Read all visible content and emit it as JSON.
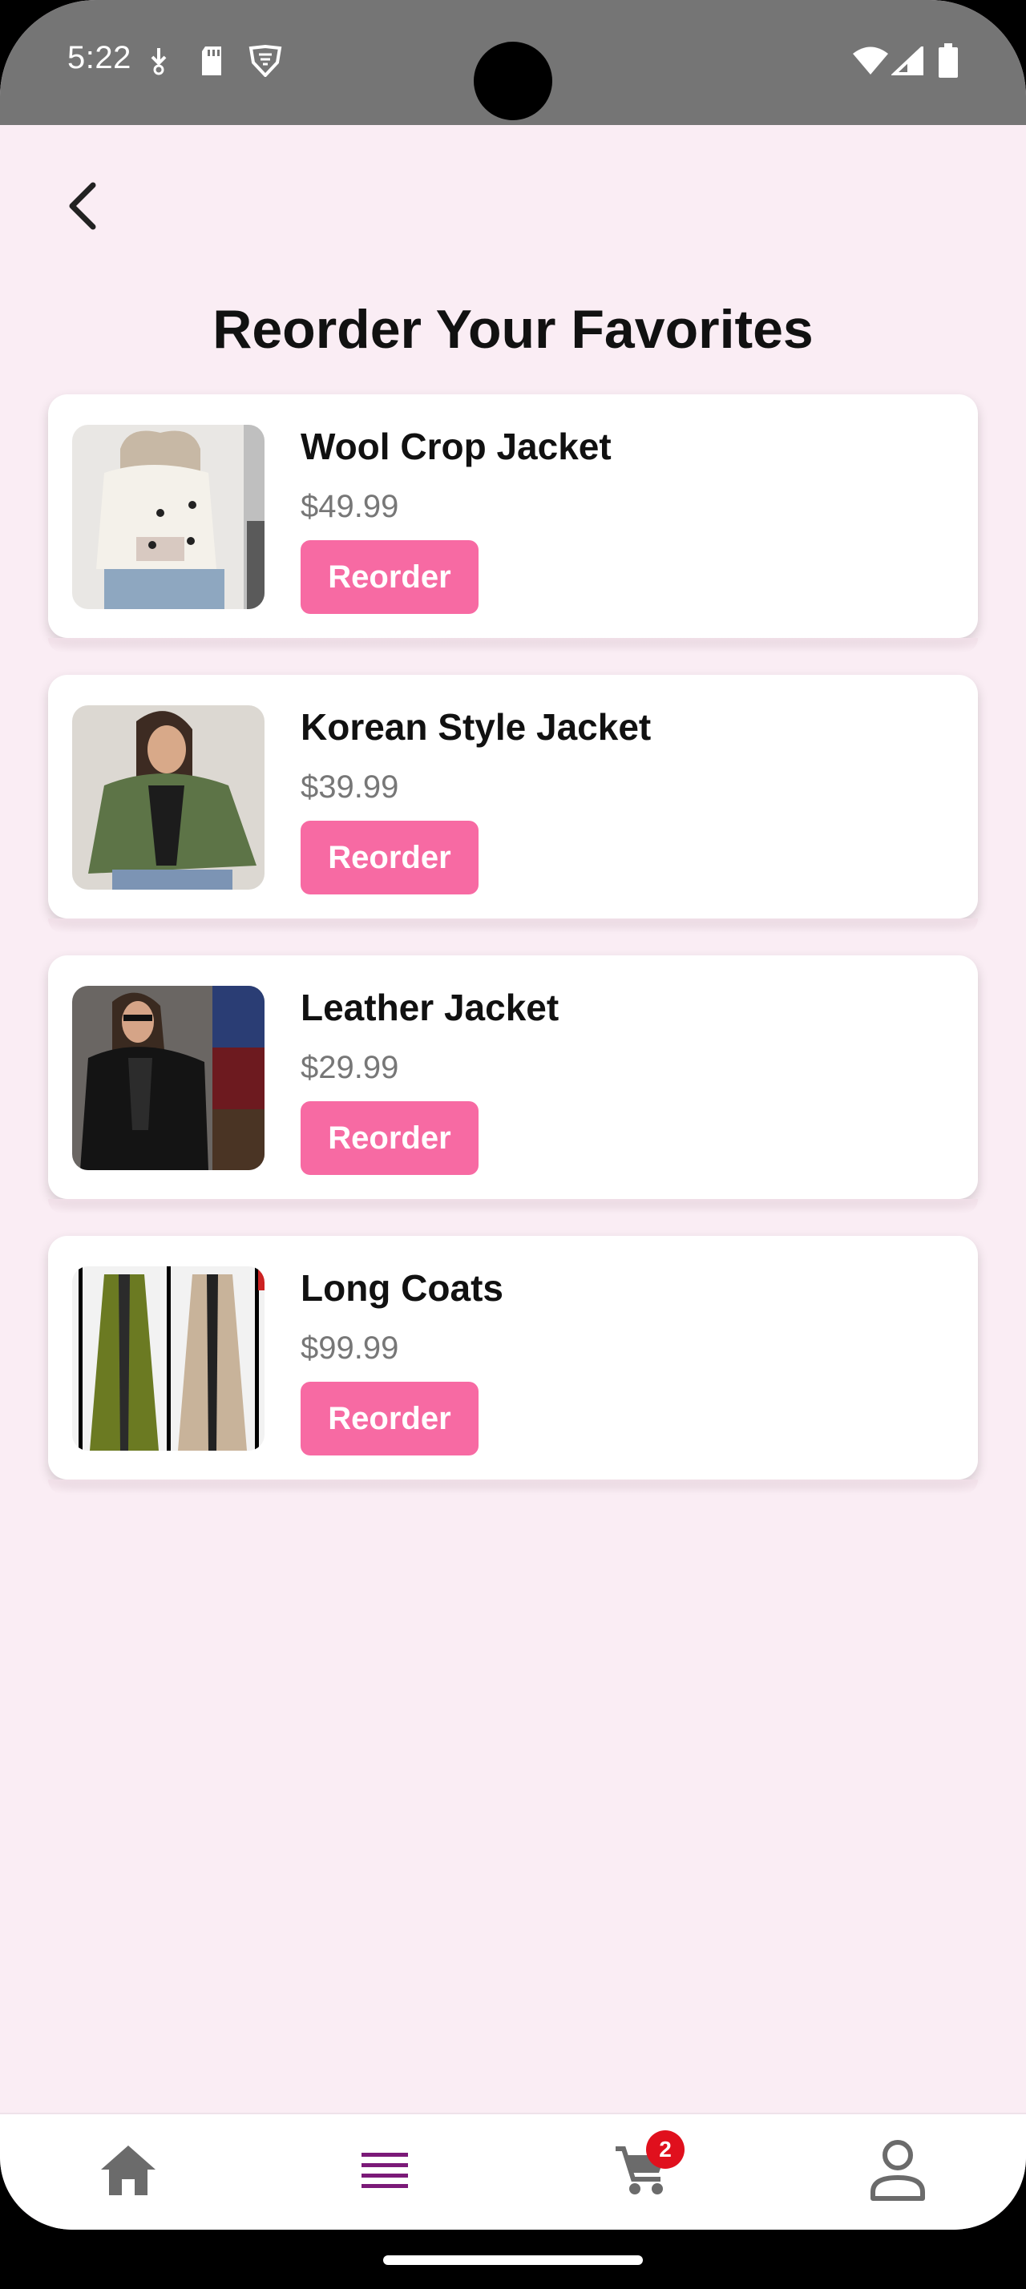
{
  "status_bar": {
    "time": "5:22"
  },
  "header": {
    "title": "Reorder Your Favorites"
  },
  "items": [
    {
      "name": "Wool Crop Jacket",
      "price": "$49.99",
      "button_label": "Reorder"
    },
    {
      "name": "Korean Style Jacket",
      "price": "$39.99",
      "button_label": "Reorder"
    },
    {
      "name": "Leather Jacket",
      "price": "$29.99",
      "button_label": "Reorder"
    },
    {
      "name": "Long Coats",
      "price": "$99.99",
      "button_label": "Reorder"
    }
  ],
  "bottom_nav": {
    "items": [
      "home-icon",
      "menu-icon",
      "cart-icon",
      "profile-icon"
    ],
    "active": "menu-icon",
    "cart_badge": "2"
  },
  "colors": {
    "background": "#faedf4",
    "accent": "#f76aa3",
    "active_nav": "#7b1a78",
    "badge": "#e0101d"
  }
}
